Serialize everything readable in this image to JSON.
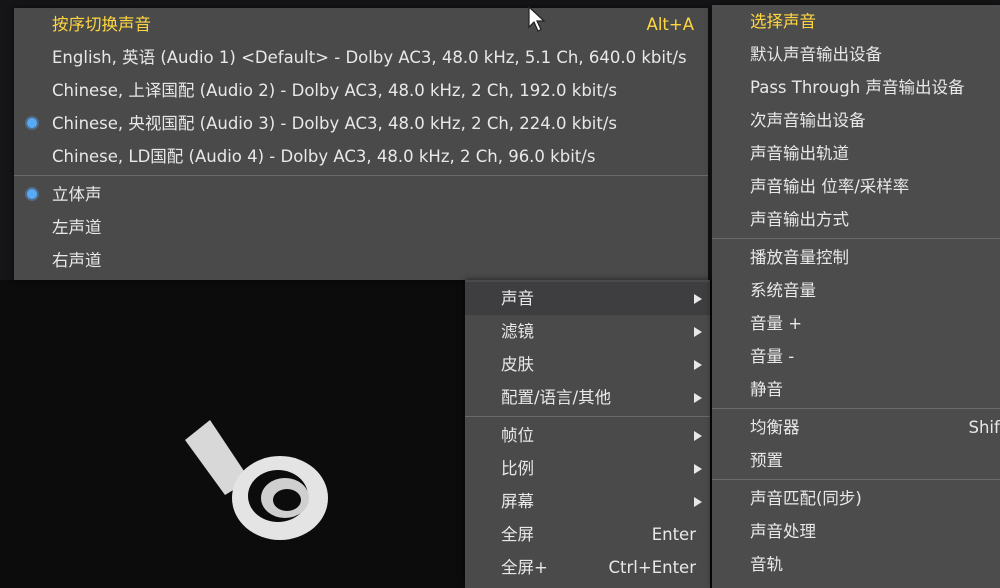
{
  "audio_menu": {
    "header": {
      "label": "按序切换声音",
      "shortcut": "Alt+A"
    },
    "tracks": [
      {
        "label": "English, 英语 (Audio 1) <Default> - Dolby AC3, 48.0 kHz, 5.1 Ch, 640.0 kbit/s",
        "selected": false
      },
      {
        "label": "Chinese, 上译国配 (Audio 2) - Dolby AC3, 48.0 kHz, 2 Ch, 192.0 kbit/s",
        "selected": false
      },
      {
        "label": "Chinese, 央视国配 (Audio 3) - Dolby AC3, 48.0 kHz, 2 Ch, 224.0 kbit/s",
        "selected": true
      },
      {
        "label": "Chinese, LD国配 (Audio 4) - Dolby AC3, 48.0 kHz, 2 Ch, 96.0 kbit/s",
        "selected": false
      }
    ],
    "channels": [
      {
        "label": "立体声",
        "selected": true
      },
      {
        "label": "左声道",
        "selected": false
      },
      {
        "label": "右声道",
        "selected": false
      }
    ]
  },
  "main_menu": {
    "items": [
      {
        "label": "声音",
        "submenu": true,
        "active": true
      },
      {
        "label": "滤镜",
        "submenu": true
      },
      {
        "label": "皮肤",
        "submenu": true
      },
      {
        "label": "配置/语言/其他",
        "submenu": true
      },
      {
        "label": "帧位",
        "submenu": true
      },
      {
        "label": "比例",
        "submenu": true
      },
      {
        "label": "屏幕",
        "submenu": true
      },
      {
        "label": "全屏",
        "shortcut": "Enter"
      },
      {
        "label": "全屏+",
        "shortcut": "Ctrl+Enter"
      }
    ]
  },
  "sound_submenu": {
    "group1": [
      "选择声音",
      "默认声音输出设备",
      "Pass Through 声音输出设备",
      "次声音输出设备",
      "声音输出轨道",
      "声音输出 位率/采样率",
      "声音输出方式"
    ],
    "group2": [
      "播放音量控制",
      "系统音量",
      "音量 +",
      "音量 -",
      "静音"
    ],
    "group3": [
      "均衡器",
      "预置"
    ],
    "group3_shortcut": "Shift",
    "group4": [
      "声音匹配(同步)",
      "声音处理",
      "音轨"
    ]
  },
  "colors": {
    "highlight": "#ffd640",
    "radio": "#58aaf5",
    "menu_bg": "#4a4a4b"
  }
}
